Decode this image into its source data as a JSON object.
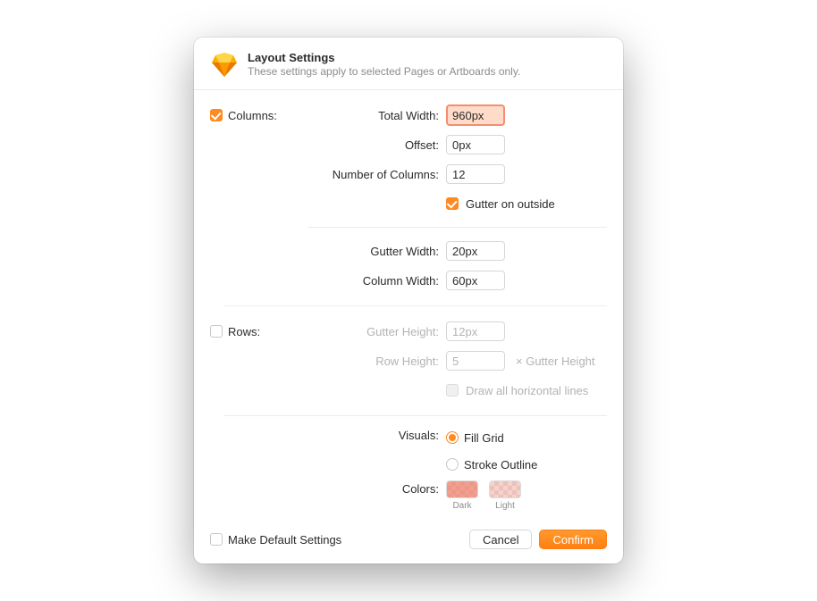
{
  "header": {
    "title": "Layout Settings",
    "subtitle": "These settings apply to selected Pages or Artboards only."
  },
  "columns": {
    "section_label": "Columns:",
    "enabled": true,
    "total_width_label": "Total Width:",
    "total_width_value": "960px",
    "offset_label": "Offset:",
    "offset_value": "0px",
    "num_columns_label": "Number of Columns:",
    "num_columns_value": "12",
    "gutter_outside_label": "Gutter on outside",
    "gutter_outside_checked": true,
    "gutter_width_label": "Gutter Width:",
    "gutter_width_value": "20px",
    "column_width_label": "Column Width:",
    "column_width_value": "60px"
  },
  "rows": {
    "section_label": "Rows:",
    "enabled": false,
    "gutter_height_label": "Gutter Height:",
    "gutter_height_value": "12px",
    "row_height_label": "Row Height:",
    "row_height_value": "5",
    "row_height_suffix": "× Gutter Height",
    "draw_lines_label": "Draw all horizontal lines",
    "draw_lines_checked": false
  },
  "visuals": {
    "label": "Visuals:",
    "options": {
      "fill": "Fill Grid",
      "stroke": "Stroke Outline"
    },
    "selected": "fill"
  },
  "colors": {
    "label": "Colors:",
    "dark_label": "Dark",
    "dark_value": "#f08e7c",
    "light_label": "Light",
    "light_value": "#f5beb4"
  },
  "footer": {
    "make_default_label": "Make Default Settings",
    "make_default_checked": false,
    "cancel_label": "Cancel",
    "confirm_label": "Confirm"
  }
}
